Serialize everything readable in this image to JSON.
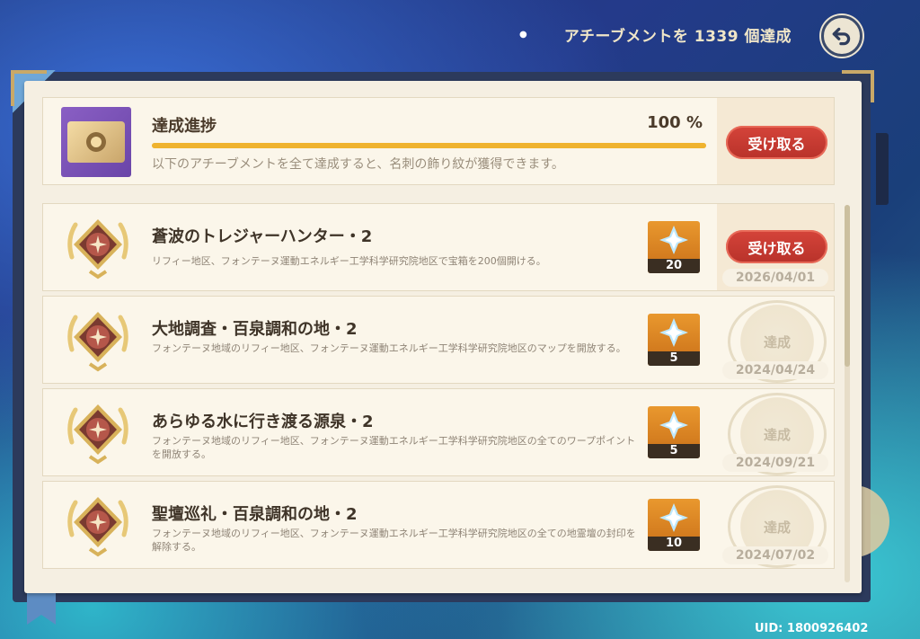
{
  "header": {
    "summary": "アチーブメントを 1339 個達成",
    "back_icon": "back-arrow-icon"
  },
  "progress": {
    "title": "達成進捗",
    "percent_label": "100 %",
    "percent_value": 100,
    "description": "以下のアチーブメントを全て達成すると、名刺の飾り紋が獲得できます。",
    "claim_label": "受け取る"
  },
  "achievements": [
    {
      "title": "蒼波のトレジャーハンター・2",
      "description": "リフィー地区、フォンテーヌ運動エネルギー工学科学研究院地区で宝箱を200個開ける。",
      "reward_count": "20",
      "date": "2026/04/01",
      "claim_label": "受け取る"
    },
    {
      "title": "大地調査・百泉調和の地・2",
      "description": "フォンテーヌ地域のリフィー地区、フォンテーヌ運動エネルギー工学科学研究院地区のマップを開放する。",
      "reward_count": "5",
      "date": "2024/04/24",
      "status": "達成"
    },
    {
      "title": "あらゆる水に行き渡る源泉・2",
      "description": "フォンテーヌ地域のリフィー地区、フォンテーヌ運動エネルギー工学科学研究院地区の全てのワープポイントを開放する。",
      "reward_count": "5",
      "date": "2024/09/21",
      "status": "達成"
    },
    {
      "title": "聖壇巡礼・百泉調和の地・2",
      "description": "フォンテーヌ地域のリフィー地区、フォンテーヌ運動エネルギー工学科学研究院地区の全ての地霊壇の封印を解除する。",
      "reward_count": "10",
      "date": "2024/07/02",
      "status": "達成"
    }
  ],
  "uid": "UID: 1800926402",
  "colors": {
    "accent_red": "#c23a30",
    "progress_gold": "#efb32f",
    "paper": "#f5efe2"
  }
}
